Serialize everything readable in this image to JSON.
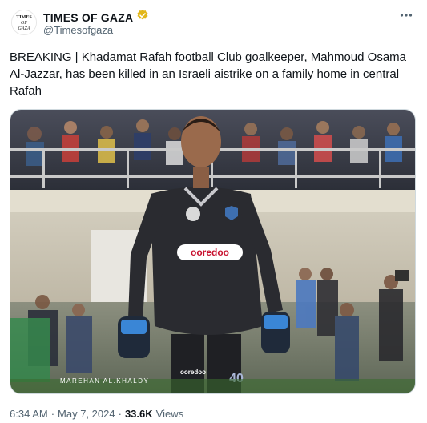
{
  "author": {
    "display_name": "TIMES OF GAZA",
    "handle": "@Timesofgaza",
    "avatar_text": [
      "TIMES",
      "OF",
      "GAZA"
    ],
    "verified_color": "#e2b719"
  },
  "tweet": {
    "text": "BREAKING | Khadamat Rafah football Club goalkeeper, Mahmoud Osama Al-Jazzar, has been killed in an Israeli aistrike on a family home in central Rafah",
    "more_icon": "more-horizontal-icon"
  },
  "media": {
    "watermark": "MAREHAN AL.KHALDY",
    "jersey_sponsor": "ooredoo",
    "shorts_sponsor": "ooredoo",
    "jersey_number": "40"
  },
  "footer": {
    "time": "6:34 AM",
    "date": "May 7, 2024",
    "separator": "·",
    "views_count": "33.6K",
    "views_label": "Views"
  },
  "colors": {
    "text_primary": "#0f1419",
    "text_secondary": "#536471",
    "border": "#cfd9de"
  }
}
